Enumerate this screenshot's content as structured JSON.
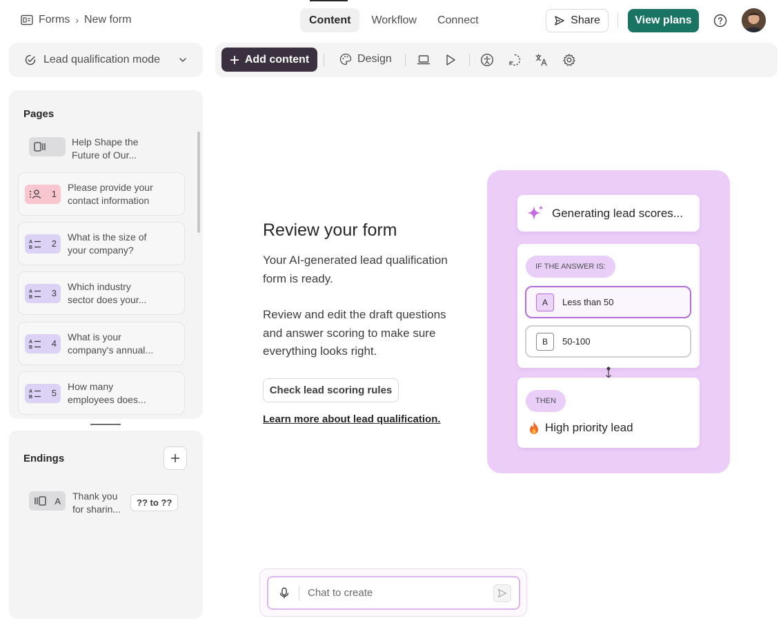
{
  "breadcrumb": {
    "root": "Forms",
    "separator": "›",
    "current": "New form"
  },
  "tabs": [
    {
      "label": "Content",
      "active": true
    },
    {
      "label": "Workflow",
      "active": false
    },
    {
      "label": "Connect",
      "active": false
    }
  ],
  "header": {
    "share_label": "Share",
    "plans_label": "View plans"
  },
  "mode": {
    "label": "Lead qualification mode"
  },
  "toolbar": {
    "add_label": "Add content",
    "design_label": "Design"
  },
  "pages": {
    "title": "Pages",
    "welcome": {
      "text": "Help Shape the Future of Our..."
    },
    "items": [
      {
        "number": "1",
        "text": "Please provide your contact information",
        "kind": "contact"
      },
      {
        "number": "2",
        "text": "What is the size of your company?",
        "kind": "choice"
      },
      {
        "number": "3",
        "text": "Which industry sector does your...",
        "kind": "choice"
      },
      {
        "number": "4",
        "text": "What is your company's annual...",
        "kind": "choice"
      },
      {
        "number": "5",
        "text": "How many employees does...",
        "kind": "choice"
      }
    ]
  },
  "endings": {
    "title": "Endings",
    "item": {
      "letter": "A",
      "text": "Thank you for sharin...",
      "score": "?? to ??"
    }
  },
  "review": {
    "title": "Review your form",
    "p1": "Your AI-generated lead qualification form is ready.",
    "p2": "Review and edit the draft questions and answer scoring to make sure everything looks right.",
    "check_label": "Check lead scoring rules",
    "learn_label": "Learn more about lead qualification."
  },
  "illustration": {
    "generating": "Generating lead scores...",
    "if_label": "IF THE ANSWER IS:",
    "options": [
      {
        "letter": "A",
        "text": "Less than 50",
        "selected": true
      },
      {
        "letter": "B",
        "text": "50-100",
        "selected": false
      }
    ],
    "then_label": "THEN",
    "result": "High priority lead"
  },
  "chat": {
    "placeholder": "Chat to create"
  },
  "colors": {
    "brand": "#1a7463",
    "add_button": "#3a3040",
    "illustration_bg": "#eccdf8",
    "accent_purple": "#b46cd6"
  }
}
